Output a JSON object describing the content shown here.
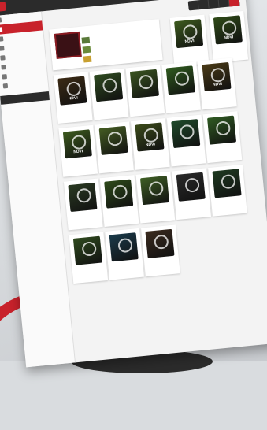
{
  "app": {
    "brand": "",
    "logo_letter": ""
  },
  "page_title": "",
  "navbar": {
    "items": [
      "",
      "",
      "",
      "",
      ""
    ]
  },
  "sidebar": {
    "items": [
      "",
      "",
      "",
      "",
      "",
      "",
      "",
      ""
    ],
    "section_header": "",
    "sub_items": [
      "",
      ""
    ]
  },
  "featured": {
    "caption": "",
    "lines": [
      "",
      "",
      "",
      ""
    ]
  },
  "tiles": [
    {
      "tag": "NDVI",
      "name": "",
      "color": "#3d5a1e"
    },
    {
      "tag": "NDVI",
      "name": "",
      "color": "#2f4a18"
    },
    {
      "tag": "NDVI",
      "name": "",
      "color": "#3b2a14"
    },
    {
      "tag": "",
      "name": "",
      "color": "#2e4a20"
    },
    {
      "tag": "",
      "name": "",
      "color": "#3a5520"
    },
    {
      "tag": "",
      "name": "",
      "color": "#2f5a1e"
    },
    {
      "tag": "NDVI",
      "name": "",
      "color": "#4a3a16"
    },
    {
      "tag": "NDVI",
      "name": "",
      "color": "#3d5a1e"
    },
    {
      "tag": "",
      "name": "",
      "color": "#445c22"
    },
    {
      "tag": "NDVI",
      "name": "",
      "color": "#3b4a1a"
    },
    {
      "tag": "",
      "name": "",
      "color": "#1f4a2a"
    },
    {
      "tag": "",
      "name": "",
      "color": "#2f5a22"
    },
    {
      "tag": "",
      "name": "",
      "color": "#2a3a22"
    },
    {
      "tag": "",
      "name": "",
      "color": "#2e4a1a"
    },
    {
      "tag": "",
      "name": "",
      "color": "#3e5e24"
    },
    {
      "tag": "",
      "name": "",
      "color": "#2a2a2a"
    },
    {
      "tag": "",
      "name": "",
      "color": "#1e3a20"
    },
    {
      "tag": "",
      "name": "",
      "color": "#2f4a1e"
    },
    {
      "tag": "",
      "name": "",
      "color": "#1a3a4a"
    },
    {
      "tag": "",
      "name": "",
      "color": "#3a2a1e"
    }
  ],
  "colors": {
    "accent": "#c8222b",
    "dark": "#2b2b2b"
  }
}
